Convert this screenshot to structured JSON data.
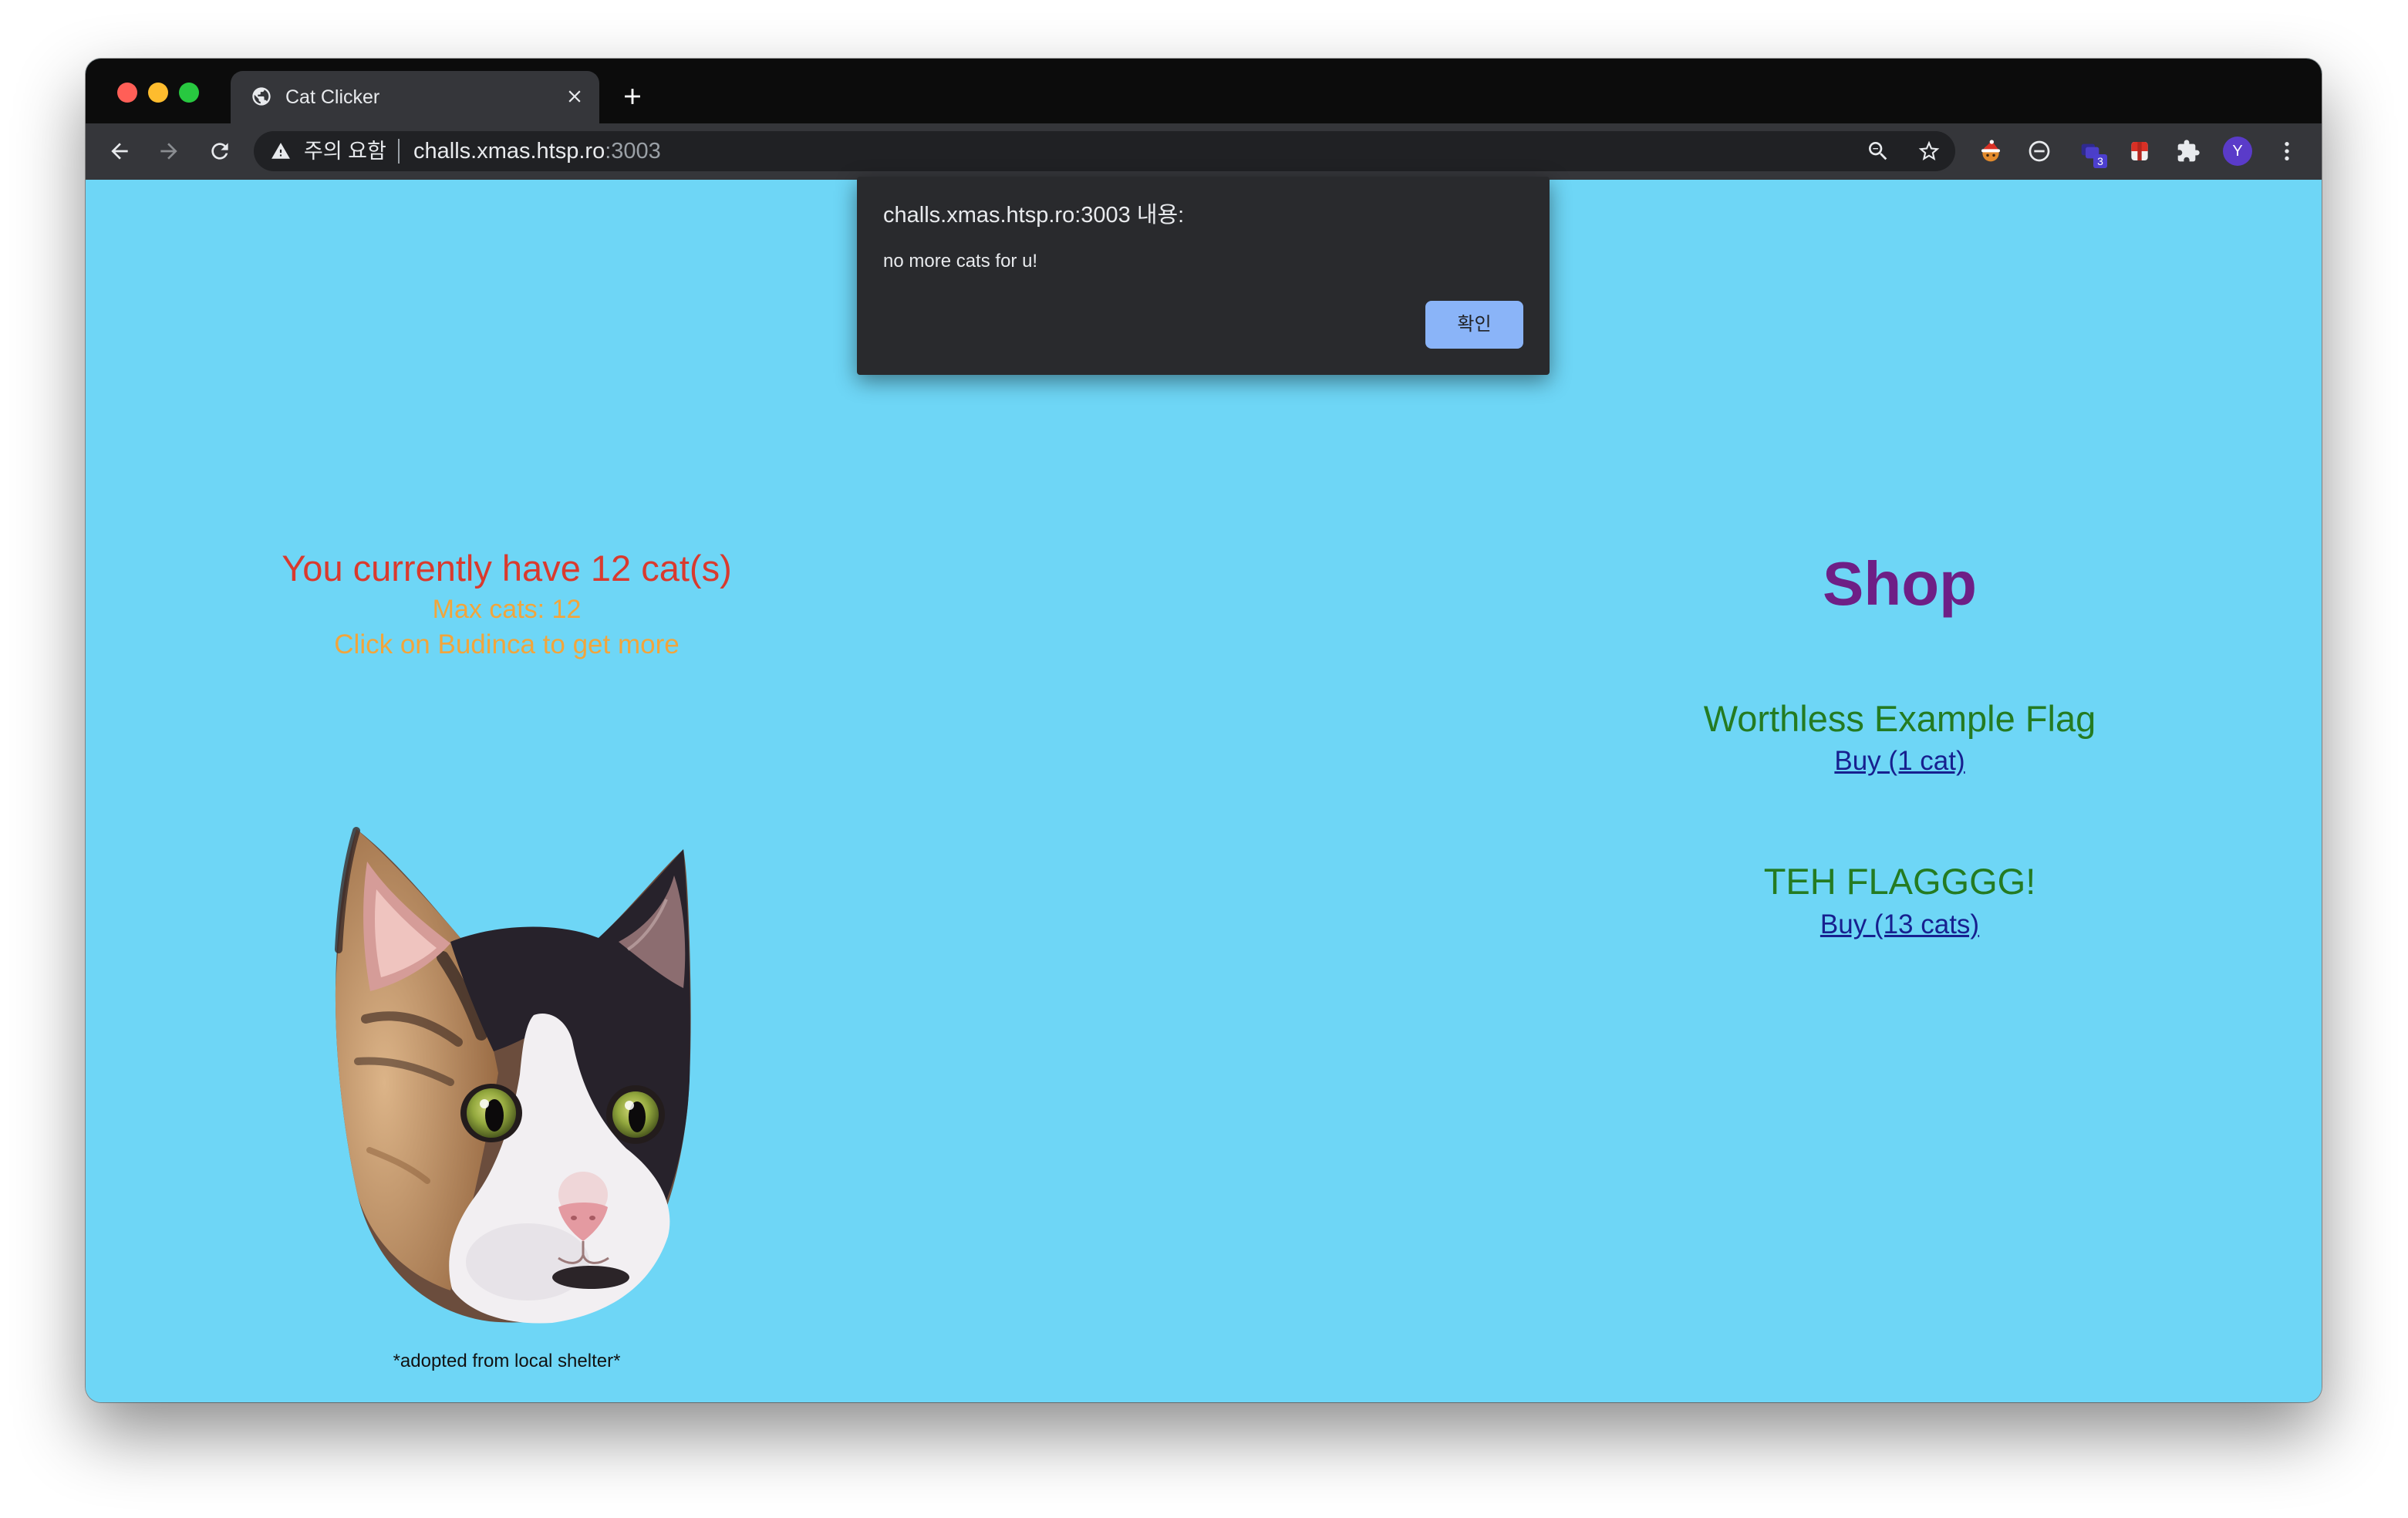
{
  "browser": {
    "tab_title": "Cat Clicker",
    "omnibox": {
      "security_label": "주의 요함",
      "host": "challs.xmas.htsp.ro",
      "port": ":3003"
    },
    "extension_badge": "3",
    "profile_initial": "Y",
    "icons": {
      "favicon": "globe-icon",
      "tab_close": "close-icon",
      "new_tab": "plus-icon",
      "back": "back-arrow-icon",
      "forward": "forward-arrow-icon",
      "reload": "reload-icon",
      "security": "warning-icon",
      "zoom": "zoom-out-icon",
      "bookmark": "star-icon",
      "extensions": "puzzle-icon",
      "menu": "kebab-menu-icon"
    }
  },
  "alert": {
    "title": "challs.xmas.htsp.ro:3003 내용:",
    "message": "no more cats for u!",
    "ok_label": "확인"
  },
  "game": {
    "cat_count_text": "You currently have 12 cat(s)",
    "max_cats_text": "Max cats: 12",
    "hint_text": "Click on Budinca to get more",
    "caption": "*adopted from local shelter*"
  },
  "shop": {
    "title": "Shop",
    "items": [
      {
        "name": "Worthless Example Flag",
        "buy_label": "Buy (1 cat)"
      },
      {
        "name": "TEH FLAGGGG!",
        "buy_label": "Buy (13 cats)"
      }
    ]
  },
  "colors": {
    "page_background": "#6ed6f6",
    "cat_count": "#d93a2e",
    "hint": "#f2a53b",
    "shop_title": "#6e1f86",
    "item_name": "#247b22",
    "link": "#17208f",
    "dialog_background": "#292a2d",
    "dialog_button": "#8ab4f8"
  }
}
